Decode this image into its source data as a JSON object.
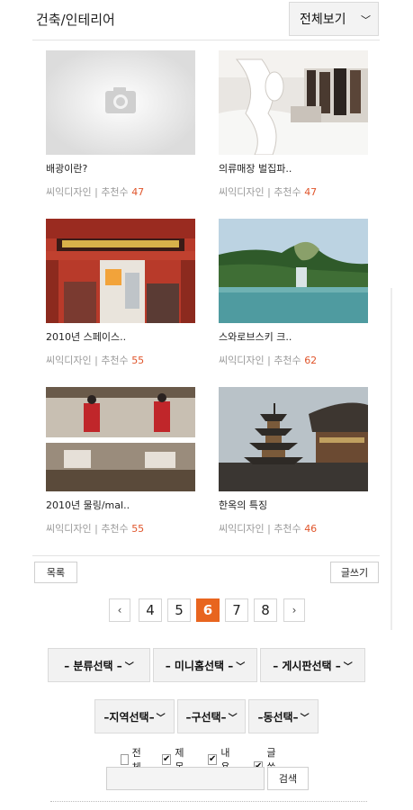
{
  "header": {
    "title": "건축/인테리어",
    "view_all_label": "전체보기"
  },
  "posts": [
    {
      "title": "배광이란?",
      "author": "씨익디자인",
      "rec_label": "추천수",
      "count": "47"
    },
    {
      "title": "의류매장 벌집파..",
      "author": "씨익디자인",
      "rec_label": "추천수",
      "count": "47"
    },
    {
      "title": "2010년 스페이스..",
      "author": "씨익디자인",
      "rec_label": "추천수",
      "count": "55"
    },
    {
      "title": "스와로브스키 크..",
      "author": "씨익디자인",
      "rec_label": "추천수",
      "count": "62"
    },
    {
      "title": "2010년 물링/mal..",
      "author": "씨익디자인",
      "rec_label": "추천수",
      "count": "55"
    },
    {
      "title": "한옥의 특징",
      "author": "씨익디자인",
      "rec_label": "추천수",
      "count": "46"
    }
  ],
  "actions": {
    "list_label": "목록",
    "write_label": "글쓰기"
  },
  "pagination": {
    "prev": "‹",
    "next": "›",
    "pages": [
      "4",
      "5",
      "6",
      "7",
      "8"
    ],
    "current": "6"
  },
  "filters": {
    "category": "– 분류선택 –",
    "minihome": "– 미니홈선택 –",
    "board": "– 게시판선택 –",
    "region": "–지역선택–",
    "district": "–구선택–",
    "dong": "–동선택–"
  },
  "search": {
    "options": [
      {
        "label": "전체",
        "checked": false
      },
      {
        "label": "제목",
        "checked": true
      },
      {
        "label": "내용",
        "checked": true
      },
      {
        "label": "글쓴이",
        "checked": true
      }
    ],
    "value": "",
    "button_label": "검색"
  },
  "colors": {
    "accent": "#e8651f",
    "count": "#e0552b"
  }
}
